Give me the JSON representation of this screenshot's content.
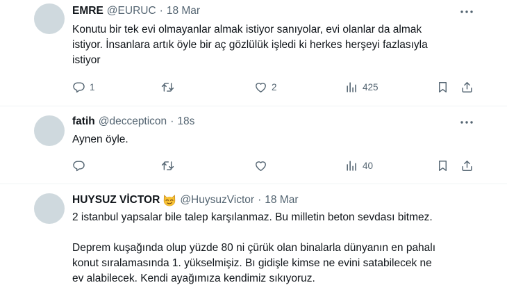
{
  "tweets": [
    {
      "name": "EMRE",
      "handle": "@EURUC",
      "separator": "·",
      "time": "18 Mar",
      "text": [
        "Konutu bir tek evi olmayanlar almak istiyor sanıyolar, evi olanlar da almak",
        "istiyor. İnsanlara artık öyle bir aç gözlülük işledi ki herkes herşeyi fazlasıyla",
        "istiyor"
      ],
      "replies": "1",
      "retweets": "",
      "likes": "2",
      "views": "425"
    },
    {
      "name": "fatih",
      "handle": "@deccepticon",
      "separator": "·",
      "time": "18s",
      "text": [
        "Aynen öyle."
      ],
      "replies": "",
      "retweets": "",
      "likes": "",
      "views": "40"
    },
    {
      "name": "HUYSUZ VİCTOR",
      "handle": "@HuysuzVictor",
      "separator": "·",
      "time": "18 Mar",
      "emoji": "smirking-cat-emoji",
      "text": [
        "2 istanbul yapsalar bile talep karşılanmaz. Bu milletin beton sevdası bitmez.",
        "Deprem kuşağında olup yüzde 80 ni çürük olan binalarla dünyanın en pahalı",
        "konut sıralamasında 1. yükselmişiz. Bı gidişle kimse ne evini satabilecek ne",
        "ev alabilecek. Kendi ayağımıza kendimiz sıkıyoruz."
      ]
    }
  ],
  "colors": {
    "text": "#0f1419",
    "secondary": "#536471",
    "divider": "#eff3f4",
    "avatar": "#cfd9de"
  }
}
